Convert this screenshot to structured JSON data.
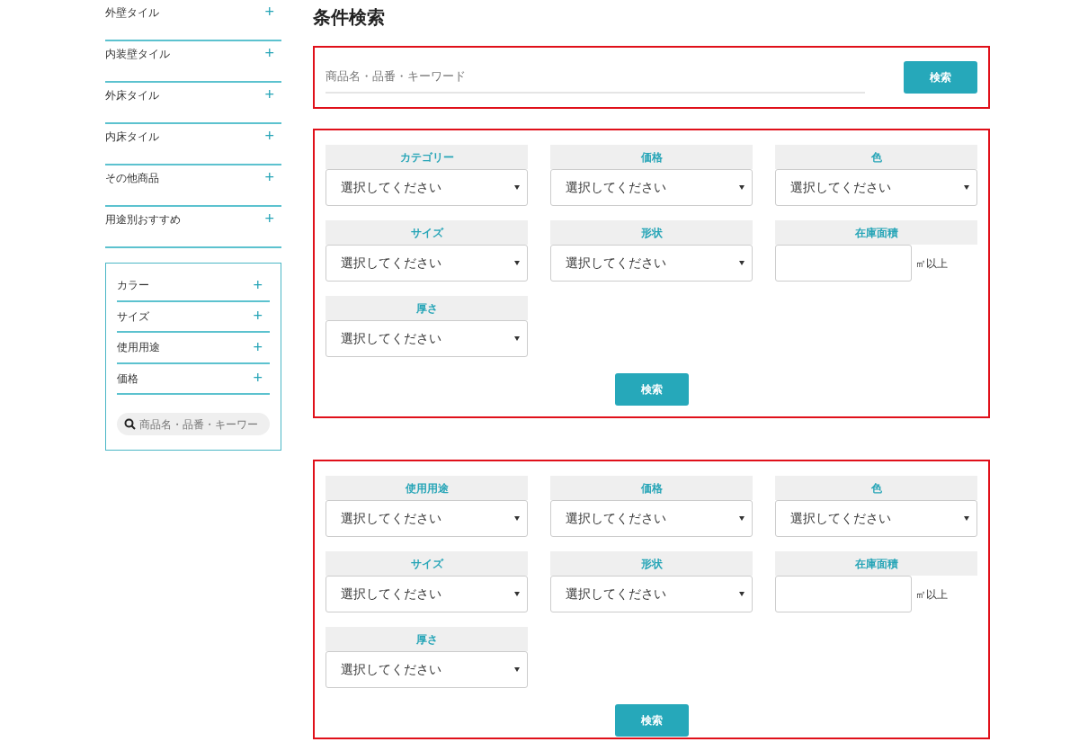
{
  "sidebar": {
    "categories": [
      {
        "label": "外壁タイル",
        "icon": "+"
      },
      {
        "label": "内装壁タイル",
        "icon": "+"
      },
      {
        "label": "外床タイル",
        "icon": "+"
      },
      {
        "label": "内床タイル",
        "icon": "+"
      },
      {
        "label": "その他商品",
        "icon": "+"
      },
      {
        "label": "用途別おすすめ",
        "icon": "+"
      }
    ],
    "filters": [
      {
        "label": "カラー",
        "icon": "+"
      },
      {
        "label": "サイズ",
        "icon": "+"
      },
      {
        "label": "使用用途",
        "icon": "+"
      },
      {
        "label": "価格",
        "icon": "+"
      }
    ],
    "search": {
      "placeholder": "商品名・品番・キーワー"
    }
  },
  "title": "条件検索",
  "keyword_search": {
    "placeholder": "商品名・品番・キーワード",
    "button": "検索"
  },
  "panels": [
    {
      "fields": [
        {
          "kind": "select",
          "label": "カテゴリー",
          "value": "選択してください"
        },
        {
          "kind": "select",
          "label": "価格",
          "value": "選択してください"
        },
        {
          "kind": "select",
          "label": "色",
          "value": "選択してください"
        },
        {
          "kind": "select",
          "label": "サイズ",
          "value": "選択してください"
        },
        {
          "kind": "select",
          "label": "形状",
          "value": "選択してください"
        },
        {
          "kind": "area",
          "label": "在庫面積",
          "unit": "㎡以上"
        },
        {
          "kind": "select",
          "label": "厚さ",
          "value": "選択してください"
        }
      ],
      "button": "検索"
    },
    {
      "fields": [
        {
          "kind": "select",
          "label": "使用用途",
          "value": "選択してください"
        },
        {
          "kind": "select",
          "label": "価格",
          "value": "選択してください"
        },
        {
          "kind": "select",
          "label": "色",
          "value": "選択してください"
        },
        {
          "kind": "select",
          "label": "サイズ",
          "value": "選択してください"
        },
        {
          "kind": "select",
          "label": "形状",
          "value": "選択してください"
        },
        {
          "kind": "area",
          "label": "在庫面積",
          "unit": "㎡以上"
        },
        {
          "kind": "select",
          "label": "厚さ",
          "value": "選択してください"
        }
      ],
      "button": "検索"
    }
  ]
}
